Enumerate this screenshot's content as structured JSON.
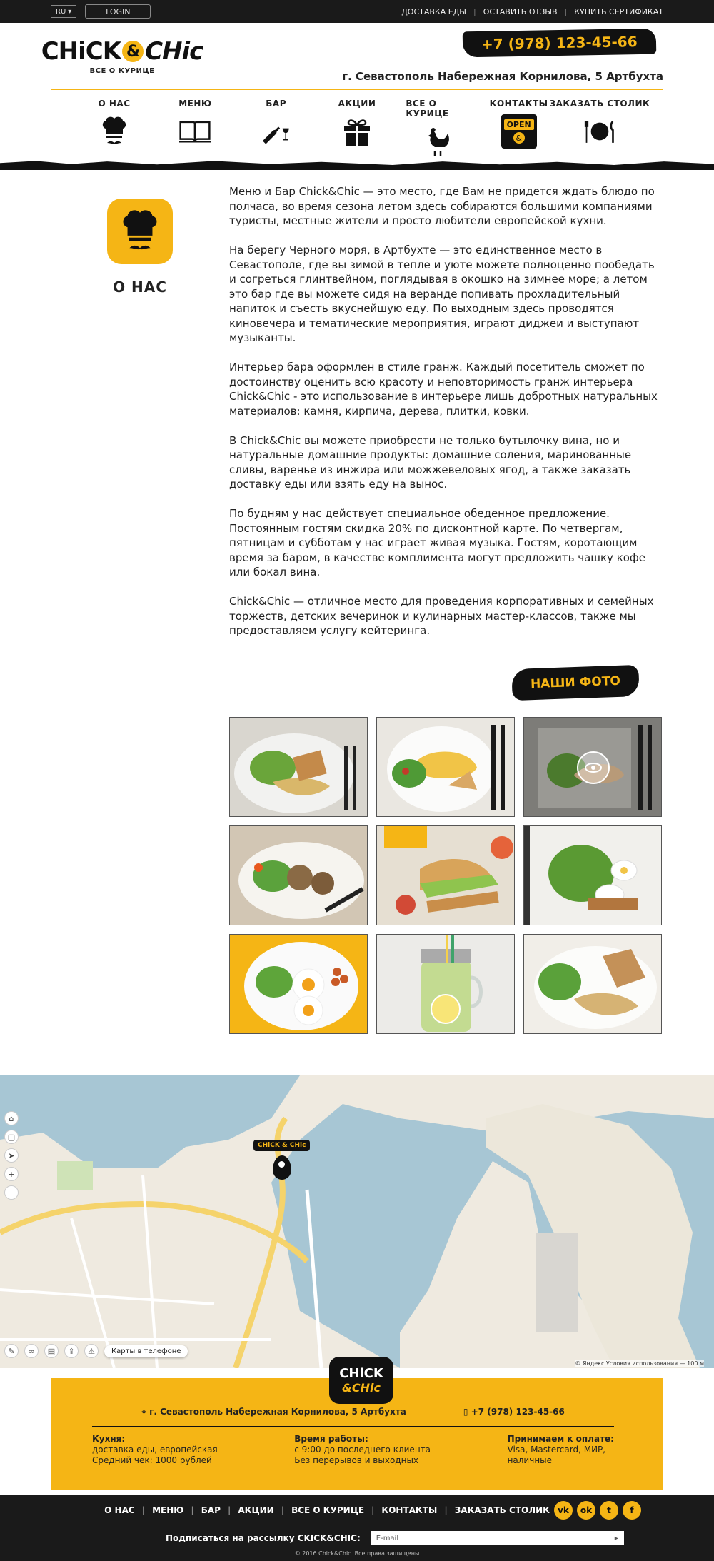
{
  "topbar": {
    "lang": "RU",
    "login": "LOGIN",
    "links": [
      "ДОСТАВКА ЕДЫ",
      "ОСТАВИТЬ ОТЗЫВ",
      "КУПИТЬ СЕРТИФИКАТ"
    ]
  },
  "header": {
    "logo_left": "CHiCK",
    "logo_amp": "&",
    "logo_right": "CHic",
    "logo_sub": "ВСЕ О КУРИЦЕ",
    "phone": "+7 (978) 123-45-66",
    "address": "г. Севастополь Набережная Корнилова, 5 Артбухта"
  },
  "nav": {
    "items": [
      {
        "label": "О НАС",
        "icon": "chef-hat-mustache-icon"
      },
      {
        "label": "МЕНЮ",
        "icon": "open-book-icon"
      },
      {
        "label": "БАР",
        "icon": "wine-bottle-glass-icon"
      },
      {
        "label": "АКЦИИ",
        "icon": "gift-icon"
      },
      {
        "label": "ВСЕ О КУРИЦЕ",
        "icon": "chicken-icon"
      },
      {
        "label": "КОНТАКТЫ",
        "icon": "open-sign-icon"
      },
      {
        "label": "ЗАКАЗАТЬ СТОЛИК",
        "icon": "plate-cutlery-icon"
      }
    ],
    "open_sign": "OPEN"
  },
  "about": {
    "title": "О НАС",
    "paragraphs": [
      "Меню и Бар Chick&Chic — это место, где Вам не придется ждать блюдо по полчаса, во время сезона летом здесь собираются большими компаниями туристы, местные жители и просто любители европейской кухни.",
      "На берегу Черного моря, в Артбухте — это единственное место в Севастополе, где вы зимой в тепле и уюте можете полноценно пообедать и согреться глинтвейном, поглядывая в окошко на зимнее море; а летом это бар где вы можете сидя на веранде попивать прохладительный напиток и съесть вкуснейшую еду.  По выходным здесь проводятся киновечера и тематические мероприятия, играют диджеи и выступают музыканты.",
      "Интерьер бара оформлен в стиле гранж. Каждый посетитель сможет по достоинству оценить всю красоту и неповторимость гранж интерьера Chick&Chic - это использование в интерьере лишь добротных натуральных материалов: камня, кирпича, дерева, плитки, ковки.",
      "В Chick&Chic вы можете приобрести не только бутылочку вина, но и натуральные домашние продукты: домашние соления, маринованные сливы, варенье из инжира или можжевеловых ягод, а также заказать доставку еды или взять еду на вынос.",
      "По будням у нас действует специальное обеденное предложение. Постоянным гостям скидка 20%  по дисконтной карте. По четвергам, пятницам и субботам у нас играет живая музыка. Гостям, коротающим время за баром, в качестве комплимента могут предложить чашку кофе или бокал вина.",
      "Chick&Chic — отличное место для проведения корпоративных и семейных торжеств, детских вечеринок и кулинарных мастер-классов, также мы предоставляем услугу кейтеринга."
    ]
  },
  "photos": {
    "title": "НАШИ ФОТО",
    "items": [
      "omelette-salad-photo",
      "omelette-toast-photo",
      "salad-plate-photo",
      "meatballs-salad-photo",
      "burger-photo",
      "egg-toast-salad-photo",
      "fried-eggs-photo",
      "lemonade-jar-photo",
      "omelette-bread-photo"
    ]
  },
  "map": {
    "phone_maps": "Карты в телефоне",
    "copyright": "© Яндекс Условия использования",
    "scale": "100 м"
  },
  "footer": {
    "logo_top": "CHiCK",
    "logo_bottom": "&CHic",
    "address": "г. Севастополь Набережная Корнилова, 5 Артбухта",
    "phone": "+7 (978) 123-45-66",
    "kitchen_title": "Кухня:",
    "kitchen_1": "доставка еды, европейская",
    "kitchen_2": "Средний чек: 1000 рублей",
    "hours_title": "Время работы:",
    "hours_1": "с 9:00 до последнего клиента",
    "hours_2": "Без перерывов и выходных",
    "pay_title": "Принимаем к оплате:",
    "pay_1": "Visa, Mastercard, МИР,",
    "pay_2": "наличные",
    "nav": [
      "О НАС",
      "МЕНЮ",
      "БАР",
      "АКЦИИ",
      "ВСЕ О КУРИЦЕ",
      "КОНТАКТЫ",
      "ЗАКАЗАТЬ СТОЛИК"
    ],
    "social": [
      "vk-icon",
      "odnoklassniki-icon",
      "twitter-icon",
      "facebook-icon"
    ],
    "subscribe": "Подписаться на рассылку CKICK&CHIC:",
    "email_placeholder": "E-mail",
    "copyright": "© 2016 Chick&Chic. Все права защищены"
  },
  "colors": {
    "accent": "#f5b515",
    "dark": "#1a1a1a"
  }
}
